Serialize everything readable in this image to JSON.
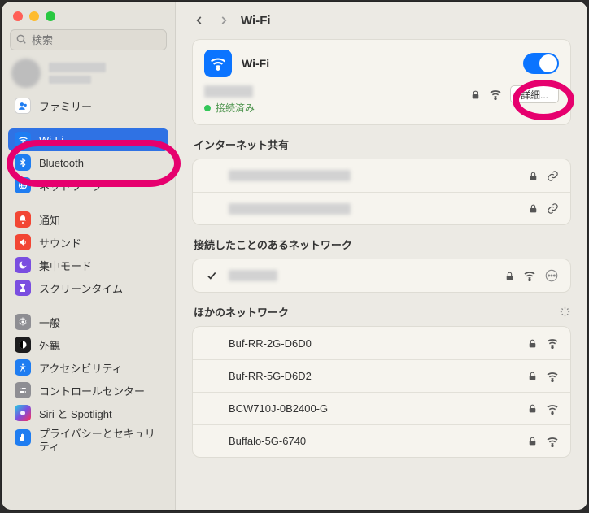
{
  "header": {
    "title": "Wi-Fi"
  },
  "search": {
    "placeholder": "検索"
  },
  "sidebar": {
    "items": [
      {
        "label": "ファミリー"
      },
      {
        "label": "Wi-Fi"
      },
      {
        "label": "Bluetooth"
      },
      {
        "label": "ネットワーク"
      },
      {
        "label": "通知"
      },
      {
        "label": "サウンド"
      },
      {
        "label": "集中モード"
      },
      {
        "label": "スクリーンタイム"
      },
      {
        "label": "一般"
      },
      {
        "label": "外観"
      },
      {
        "label": "アクセシビリティ"
      },
      {
        "label": "コントロールセンター"
      },
      {
        "label": "Siri と Spotlight"
      },
      {
        "label": "プライバシーとセキュリティ"
      }
    ]
  },
  "wifi": {
    "title": "Wi-Fi",
    "connected_status": "接続済み",
    "details_button": "詳細...",
    "sections": {
      "sharing": "インターネット共有",
      "known": "接続したことのあるネットワーク",
      "other": "ほかのネットワーク"
    },
    "other_networks": [
      {
        "name": "Buf-RR-2G-D6D0"
      },
      {
        "name": "Buf-RR-5G-D6D2"
      },
      {
        "name": "BCW710J-0B2400-G"
      },
      {
        "name": "Buffalo-5G-6740"
      }
    ]
  }
}
